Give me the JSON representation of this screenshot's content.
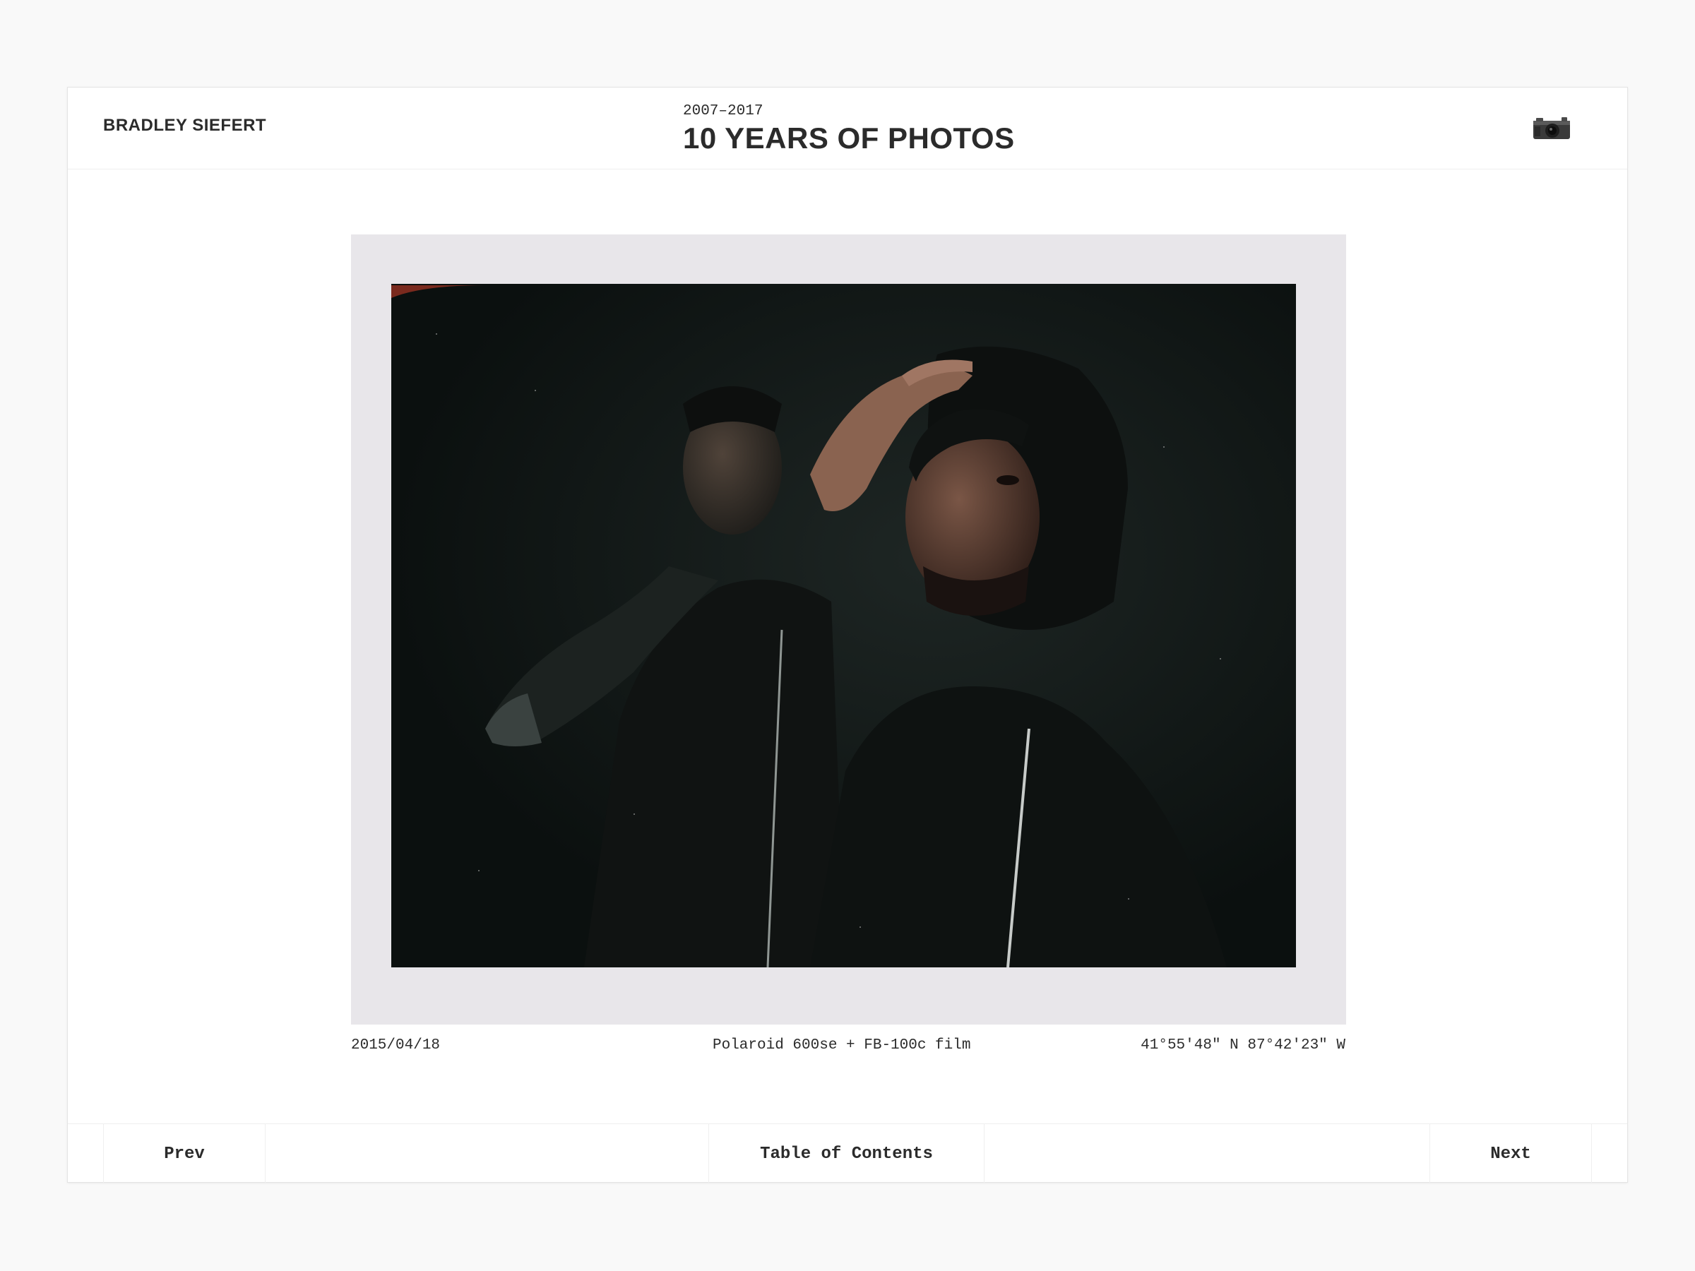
{
  "header": {
    "author": "BRADLEY SIEFERT",
    "years": "2007–2017",
    "title": "10 YEARS OF PHOTOS",
    "icon": "camera-icon"
  },
  "photo": {
    "subject": "double-exposure polaroid portrait",
    "caption": {
      "date": "2015/04/18",
      "camera": "Polaroid 600se + FB-100c film",
      "coordinates": "41°55′48″ N 87°42′23″ W"
    }
  },
  "footer": {
    "prev_label": "Prev",
    "toc_label": "Table of Contents",
    "next_label": "Next"
  },
  "colors": {
    "background": "#f9f9f9",
    "card": "#ffffff",
    "text": "#2b2b2b",
    "polaroid_border": "#e8e6ea",
    "photo_dark": "#121816"
  }
}
